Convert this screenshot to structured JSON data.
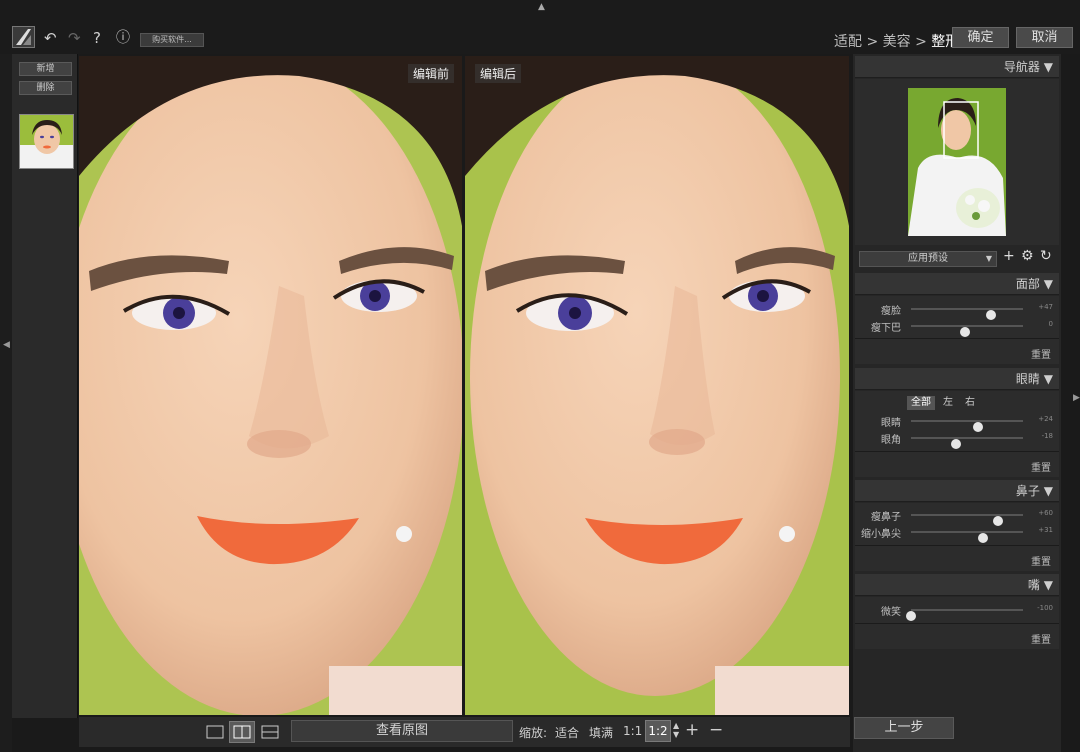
{
  "toolbar": {
    "buy_label": "购买软件...",
    "help_label": "?",
    "info_label": "ⓘ"
  },
  "breadcrumb": {
    "item1": "适配",
    "sep": ">",
    "item2": "美容",
    "item3": "整形"
  },
  "actions": {
    "confirm": "确定",
    "cancel": "取消",
    "prev_step": "上一步"
  },
  "film": {
    "add_label": "新增",
    "delete_label": "删除"
  },
  "panes": {
    "before_label": "编辑前",
    "after_label": "编辑后"
  },
  "bottom": {
    "view_original": "查看原图",
    "zoom_label": "缩放:",
    "fit": "适合",
    "fill": "填满",
    "one_to_one": "1:1",
    "current": "1:2",
    "plus": "+",
    "minus": "−"
  },
  "navigator": {
    "title": "导航器"
  },
  "preset": {
    "label": "应用预设"
  },
  "sections": {
    "face": {
      "title": "面部",
      "sliders": [
        {
          "label": "瘦脸",
          "value": "+47",
          "fraction": 0.71
        },
        {
          "label": "瘦下巴",
          "value": "0",
          "fraction": 0.48
        }
      ],
      "reset": "重置"
    },
    "eyes": {
      "title": "眼睛",
      "tabs": [
        "全部",
        "左",
        "右"
      ],
      "sliders": [
        {
          "label": "眼睛",
          "value": "+24",
          "fraction": 0.6
        },
        {
          "label": "眼角",
          "value": "-18",
          "fraction": 0.4
        }
      ],
      "reset": "重置"
    },
    "nose": {
      "title": "鼻子",
      "sliders": [
        {
          "label": "瘦鼻子",
          "value": "+60",
          "fraction": 0.78
        },
        {
          "label": "缩小鼻尖",
          "value": "+31",
          "fraction": 0.64
        }
      ],
      "reset": "重置"
    },
    "mouth": {
      "title": "嘴",
      "sliders": [
        {
          "label": "微笑",
          "value": "-100",
          "fraction": 0.0
        }
      ],
      "reset": "重置"
    }
  },
  "colors": {
    "skin": "#f0c7a6",
    "background_green": "#a9c24b",
    "lips": "#f06a3c",
    "iris": "#4a3f9a",
    "hair": "#2a1e18"
  },
  "icons": {
    "undo": "undo-icon",
    "redo": "redo-icon",
    "help": "help-icon",
    "info": "info-icon",
    "add_preset": "plus-icon",
    "preset_settings": "gear-icon",
    "preset_refresh": "refresh-icon"
  }
}
